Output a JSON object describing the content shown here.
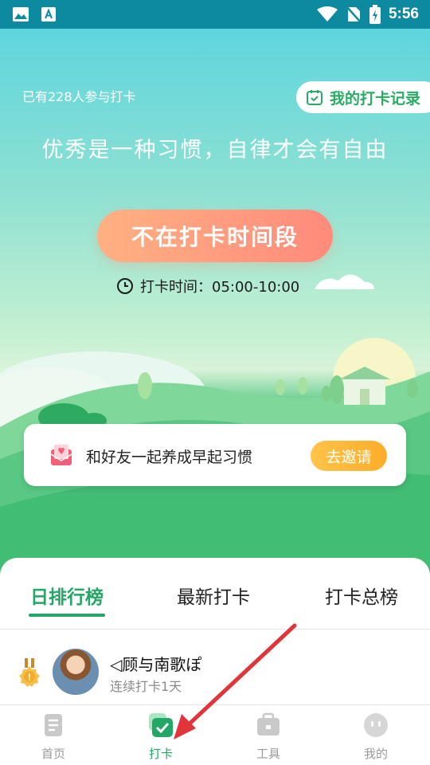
{
  "status_bar": {
    "time": "5:56"
  },
  "hero": {
    "participants": "已有228人参与打卡",
    "record_button": "我的打卡记录",
    "slogan": "优秀是一种习惯，自律才会有自由",
    "main_button": "不在打卡时间段",
    "checkin_time": "打卡时间：05:00-10:00"
  },
  "invite": {
    "text": "和好友一起养成早起习惯",
    "button": "去邀请"
  },
  "leaderboard": {
    "tabs": [
      "日排行榜",
      "最新打卡",
      "打卡总榜"
    ],
    "active_tab": 0,
    "rows": [
      {
        "name": "◁顾与南歌ぽ",
        "streak": "连续打卡1天"
      }
    ]
  },
  "tabbar": {
    "items": [
      {
        "label": "首页",
        "icon": "home-doc-icon"
      },
      {
        "label": "打卡",
        "icon": "checkin-icon"
      },
      {
        "label": "工具",
        "icon": "toolbox-icon"
      },
      {
        "label": "我的",
        "icon": "profile-icon"
      }
    ],
    "active": 1
  },
  "colors": {
    "accent": "#23a765",
    "status_bar": "#0d8a9f",
    "main_button": "#ff9a7e",
    "invite_button": "#ffb833"
  }
}
